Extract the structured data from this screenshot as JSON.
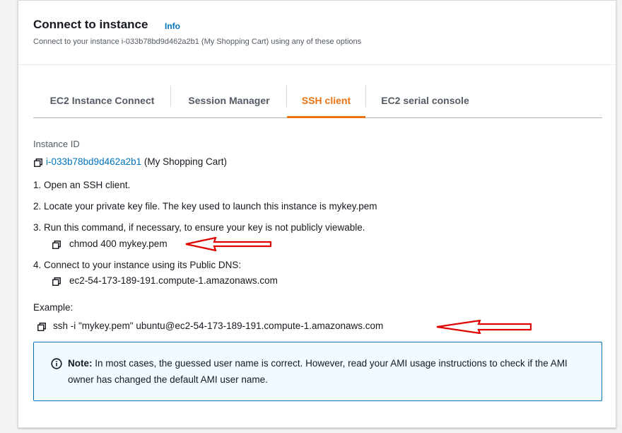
{
  "panel": {
    "title": "Connect to instance",
    "info_link": "Info",
    "subtitle": "Connect to your instance i-033b78bd9d462a2b1 (My Shopping Cart) using any of these options"
  },
  "tabs": [
    {
      "label": "EC2 Instance Connect",
      "active": false
    },
    {
      "label": "Session Manager",
      "active": false
    },
    {
      "label": "SSH client",
      "active": true
    },
    {
      "label": "EC2 serial console",
      "active": false
    }
  ],
  "instance": {
    "label": "Instance ID",
    "id": "i-033b78bd9d462a2b1",
    "name": "(My Shopping Cart)"
  },
  "steps": {
    "step1": "1. Open an SSH client.",
    "step2": "2. Locate your private key file. The key used to launch this instance is mykey.pem",
    "step3": "3. Run this command, if necessary, to ensure your key is not publicly viewable.",
    "step3_cmd": "chmod 400 mykey.pem",
    "step4": "4. Connect to your instance using its Public DNS:",
    "step4_dns": "ec2-54-173-189-191.compute-1.amazonaws.com"
  },
  "example": {
    "label": "Example:",
    "command": "ssh -i \"mykey.pem\" ubuntu@ec2-54-173-189-191.compute-1.amazonaws.com"
  },
  "note": {
    "bold": "Note:",
    "text": " In most cases, the guessed user name is correct. However, read your AMI usage instructions to check if the AMI owner has changed the default AMI user name."
  },
  "colors": {
    "accent": "#ec7211",
    "link": "#0073bb",
    "annotation_arrow": "#e00000"
  }
}
